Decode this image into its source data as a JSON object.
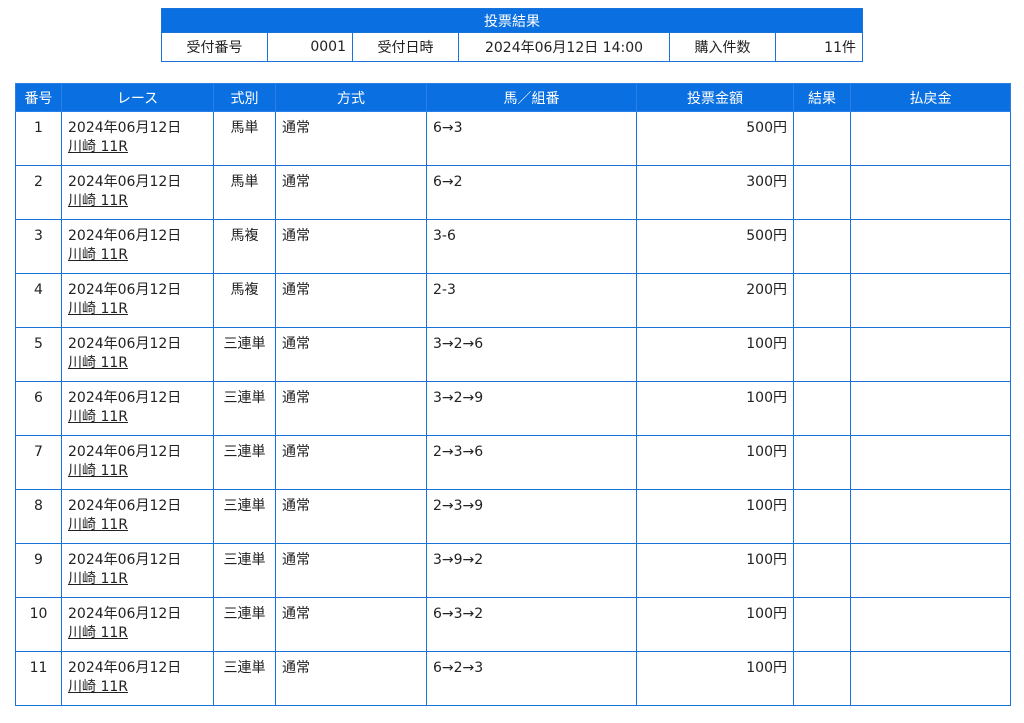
{
  "summary": {
    "title": "投票結果",
    "receipt_no_label": "受付番号",
    "receipt_no": "0001",
    "receipt_time_label": "受付日時",
    "receipt_time": "2024年06月12日 14:00",
    "purchase_count_label": "購入件数",
    "purchase_count": "11件"
  },
  "results": {
    "headers": {
      "no": "番号",
      "race": "レース",
      "bet_type": "式別",
      "method": "方式",
      "combination": "馬／組番",
      "amount": "投票金額",
      "result": "結果",
      "payout": "払戻金"
    },
    "rows": [
      {
        "no": "1",
        "date": "2024年06月12日",
        "race": "川崎 11R",
        "bet_type": "馬単",
        "method": "通常",
        "combination": "6→3",
        "amount": "500円",
        "result": "",
        "payout": ""
      },
      {
        "no": "2",
        "date": "2024年06月12日",
        "race": "川崎 11R",
        "bet_type": "馬単",
        "method": "通常",
        "combination": "6→2",
        "amount": "300円",
        "result": "",
        "payout": ""
      },
      {
        "no": "3",
        "date": "2024年06月12日",
        "race": "川崎 11R",
        "bet_type": "馬複",
        "method": "通常",
        "combination": "3-6",
        "amount": "500円",
        "result": "",
        "payout": ""
      },
      {
        "no": "4",
        "date": "2024年06月12日",
        "race": "川崎 11R",
        "bet_type": "馬複",
        "method": "通常",
        "combination": "2-3",
        "amount": "200円",
        "result": "",
        "payout": ""
      },
      {
        "no": "5",
        "date": "2024年06月12日",
        "race": "川崎 11R",
        "bet_type": "三連単",
        "method": "通常",
        "combination": "3→2→6",
        "amount": "100円",
        "result": "",
        "payout": ""
      },
      {
        "no": "6",
        "date": "2024年06月12日",
        "race": "川崎 11R",
        "bet_type": "三連単",
        "method": "通常",
        "combination": "3→2→9",
        "amount": "100円",
        "result": "",
        "payout": ""
      },
      {
        "no": "7",
        "date": "2024年06月12日",
        "race": "川崎 11R",
        "bet_type": "三連単",
        "method": "通常",
        "combination": "2→3→6",
        "amount": "100円",
        "result": "",
        "payout": ""
      },
      {
        "no": "8",
        "date": "2024年06月12日",
        "race": "川崎 11R",
        "bet_type": "三連単",
        "method": "通常",
        "combination": "2→3→9",
        "amount": "100円",
        "result": "",
        "payout": ""
      },
      {
        "no": "9",
        "date": "2024年06月12日",
        "race": "川崎 11R",
        "bet_type": "三連単",
        "method": "通常",
        "combination": "3→9→2",
        "amount": "100円",
        "result": "",
        "payout": ""
      },
      {
        "no": "10",
        "date": "2024年06月12日",
        "race": "川崎 11R",
        "bet_type": "三連単",
        "method": "通常",
        "combination": "6→3→2",
        "amount": "100円",
        "result": "",
        "payout": ""
      },
      {
        "no": "11",
        "date": "2024年06月12日",
        "race": "川崎 11R",
        "bet_type": "三連単",
        "method": "通常",
        "combination": "6→2→3",
        "amount": "100円",
        "result": "",
        "payout": ""
      }
    ]
  },
  "colors": {
    "header_bg": "#0a6fe0",
    "border": "#1a73d9"
  }
}
